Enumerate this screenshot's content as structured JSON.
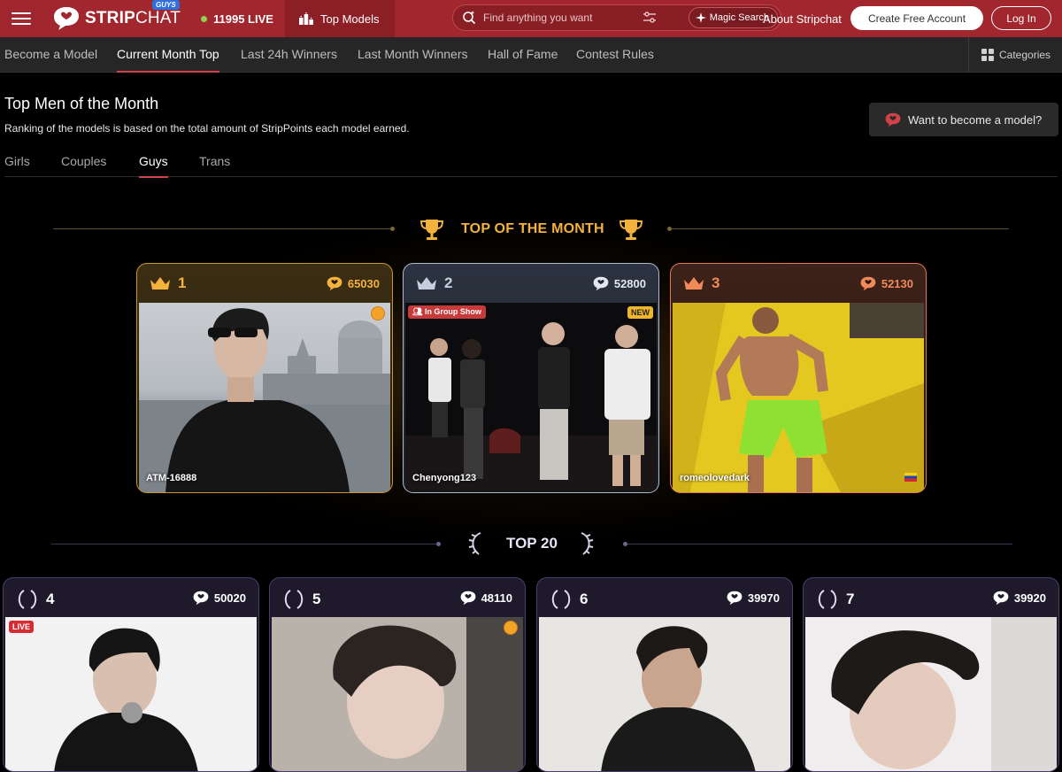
{
  "header": {
    "logo_text_a": "STRIP",
    "logo_text_b": "CHAT",
    "logo_badge": "GUYS",
    "live_count": "11995 LIVE",
    "top_models": "Top Models",
    "search_placeholder": "Find anything you want",
    "magic_search": "Magic Search",
    "about": "About Stripchat",
    "create_account": "Create Free Account",
    "login": "Log In"
  },
  "subnav": {
    "items": [
      "Become a Model",
      "Current Month Top",
      "Last 24h Winners",
      "Last Month Winners",
      "Hall of Fame",
      "Contest Rules"
    ],
    "active": "Current Month Top",
    "categories": "Categories"
  },
  "page": {
    "title": "Top Men of the Month",
    "subtitle": "Ranking of the models is based on the total amount of StripPoints each model earned.",
    "become_model": "Want to become a model?",
    "tabs": [
      "Girls",
      "Couples",
      "Guys",
      "Trans"
    ],
    "active_tab": "Guys"
  },
  "top_month": {
    "title": "TOP OF THE MONTH",
    "cards": [
      {
        "rank": "1",
        "points": "65030",
        "username": "ATM-16888",
        "tier": "gold"
      },
      {
        "rank": "2",
        "points": "52800",
        "username": "Chenyong123",
        "tier": "silver",
        "badge_left": "In Group Show",
        "badge_right": "NEW"
      },
      {
        "rank": "3",
        "points": "52130",
        "username": "romeolovedark",
        "tier": "bronze"
      }
    ]
  },
  "top20": {
    "title": "TOP 20",
    "cards": [
      {
        "rank": "4",
        "points": "50020",
        "badge_left": "LIVE"
      },
      {
        "rank": "5",
        "points": "48110"
      },
      {
        "rank": "6",
        "points": "39970"
      },
      {
        "rank": "7",
        "points": "39920"
      }
    ]
  },
  "colors": {
    "header_bg": "#a2262e",
    "accent_red": "#d3414b",
    "gold": "#f4b23d",
    "silver": "#c5cfe0",
    "bronze": "#f08a5b",
    "top20_border": "#4a3d6e"
  }
}
